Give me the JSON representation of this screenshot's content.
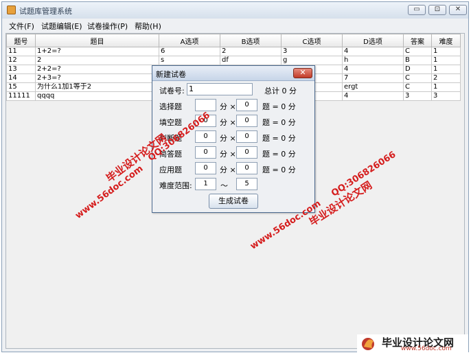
{
  "window": {
    "title": "试题库管理系统",
    "controls": [
      "▭",
      "⊡",
      "✕"
    ]
  },
  "menu": [
    "文件(F)",
    "试题编辑(E)",
    "试卷操作(P)",
    "帮助(H)"
  ],
  "table": {
    "headers": [
      "题号",
      "题目",
      "A选项",
      "B选项",
      "C选项",
      "D选项",
      "答案",
      "难度"
    ],
    "rows": [
      [
        "11",
        "1+2=?",
        "6",
        "2",
        "3",
        "4",
        "C",
        "1"
      ],
      [
        "12",
        "2",
        "s",
        "df",
        "g",
        "h",
        "B",
        "1"
      ],
      [
        "13",
        "2+2=?",
        "",
        "",
        "",
        "4",
        "D",
        "1"
      ],
      [
        "14",
        "2+3=?",
        "",
        "",
        "",
        "7",
        "C",
        "2"
      ],
      [
        "15",
        "为什么1加1等于2",
        "",
        "",
        "",
        "ergt",
        "C",
        "1"
      ],
      [
        "11111",
        "qqqq",
        "",
        "",
        "",
        "4",
        "3",
        "3"
      ]
    ]
  },
  "dialog": {
    "title": "新建试卷",
    "close": "✕",
    "paper_label": "试卷号:",
    "paper_value": "1",
    "total_text": "总计 0 分",
    "rows": [
      {
        "label": "选择题",
        "score": "",
        "count": "0",
        "result": "题 = 0 分"
      },
      {
        "label": "填空题",
        "score": "0",
        "count": "0",
        "result": "题 = 0 分"
      },
      {
        "label": "判断题",
        "score": "0",
        "count": "0",
        "result": "题 = 0 分"
      },
      {
        "label": "简答题",
        "score": "0",
        "count": "0",
        "result": "题 = 0 分"
      },
      {
        "label": "应用题",
        "score": "0",
        "count": "0",
        "result": "题 = 0 分"
      }
    ],
    "score_unit": "分 ×",
    "difficulty_label": "难度范围:",
    "difficulty_min": "1",
    "difficulty_sep": "～",
    "difficulty_max": "5",
    "generate_button": "生成试卷"
  },
  "watermarks": {
    "site_cn": "毕业设计论文网",
    "site_url": "www.56doc.com",
    "qq": "QQ:306826066",
    "logo_cn": "毕业设计论文网",
    "logo_url": "www.56doc.com"
  }
}
